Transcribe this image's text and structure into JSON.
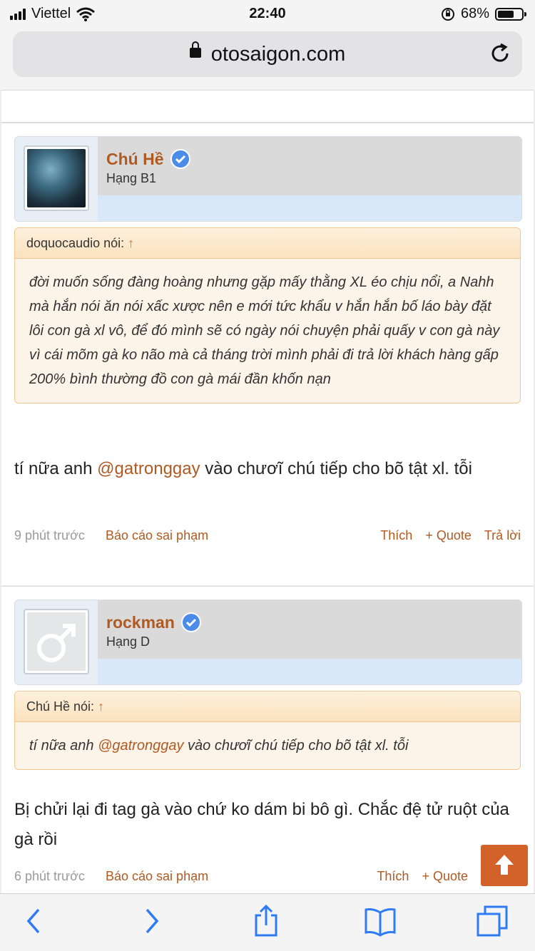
{
  "status": {
    "carrier": "Viettel",
    "time": "22:40",
    "battery": "68%",
    "battery_level": 0.68
  },
  "browser": {
    "url": "otosaigon.com"
  },
  "posts": [
    {
      "username": "Chú Hề",
      "rank": "Hạng B1",
      "quote": {
        "author_label": "doquocaudio nói:",
        "arrow": "↑",
        "text": "đời muốn sống đàng hoàng nhưng gặp mấy thằng XL éo chịu nổi, a Nahh mà hắn nói ăn nói xấc xược nên e mới tức khẩu v hắn hắn bố láo bày đặt lôi con gà xl vô, để đó mình sẽ có ngày nói chuyện phải quấy v con gà này vì cái mõm gà ko não mà cả tháng trời mình phải đi trả lời khách hàng gấp 200% bình thường đồ con gà mái đần khốn nạn"
      },
      "message": {
        "before": "tí nữa anh ",
        "mention": "@gatronggay",
        "after": " vào chươĩ chú tiếp cho bõ tật xl. tỗi"
      },
      "time": "9 phút trước",
      "report": "Báo cáo sai phạm",
      "like": "Thích",
      "quote_action": "+ Quote",
      "reply": "Trả lời"
    },
    {
      "username": "rockman",
      "rank": "Hạng D",
      "quote": {
        "author_label": "Chú Hề nói:",
        "arrow": "↑",
        "before": "tí nữa anh ",
        "mention": "@gatronggay",
        "after": " vào chươĩ chú tiếp cho bõ tật xl. tỗi"
      },
      "message": {
        "text": "Bị chửi lại đi tag gà vào chứ ko dám bi bô gì. Chắc đệ tử ruột của gà rồi"
      },
      "time": "6 phút trước",
      "report": "Báo cáo sai phạm",
      "like": "Thích",
      "quote_action": "+ Quote"
    }
  ],
  "colors": {
    "accent": "#b05a22",
    "button": "#d2612a",
    "ios_blue": "#2f7bf6",
    "verified": "#4a8ce8"
  }
}
